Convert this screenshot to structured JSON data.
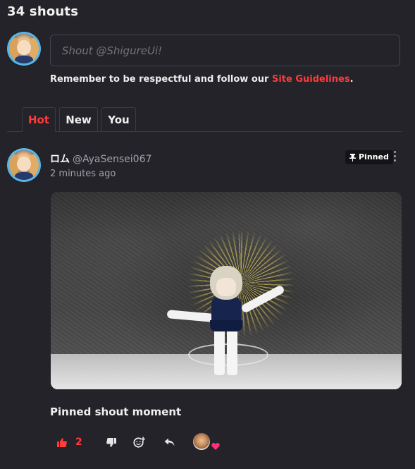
{
  "header": {
    "shout_count_title": "34 shouts"
  },
  "composer": {
    "placeholder": "Shout @ShigureUi!",
    "guidelines_prefix": "Remember to be respectful and follow our ",
    "guidelines_link": "Site Guidelines",
    "guidelines_suffix": "."
  },
  "tabs": [
    {
      "label": "Hot",
      "active": true
    },
    {
      "label": "New",
      "active": false
    },
    {
      "label": "You",
      "active": false
    }
  ],
  "post": {
    "author_name": "ロム",
    "author_handle": "@AyaSensei067",
    "time_ago": "2 minutes ago",
    "pinned_label": "Pinned",
    "caption": "Pinned shout moment",
    "like_count": "2"
  },
  "colors": {
    "accent_red": "#ff3b3b",
    "background": "#232329",
    "muted_text": "#a1a1aa",
    "avatar_ring": "#58b6e6",
    "reaction_heart": "#ff2f7a"
  },
  "icons": {
    "like": "thumbs-up-icon",
    "dislike": "thumbs-down-icon",
    "react": "add-reaction-icon",
    "reply": "reply-arrow-icon",
    "pin": "pin-icon",
    "more": "vertical-ellipsis-icon",
    "reaction_heart": "heart-icon"
  }
}
